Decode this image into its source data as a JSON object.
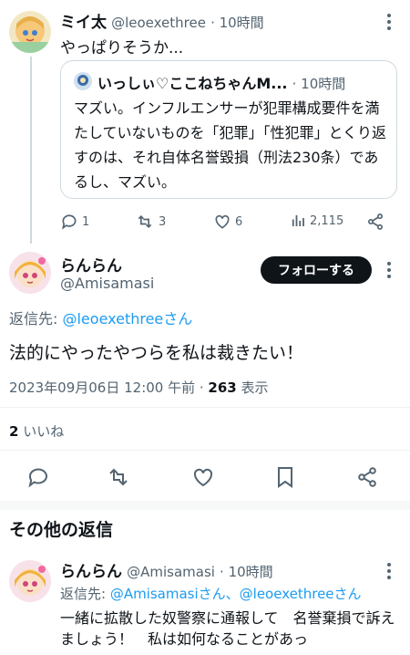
{
  "tweet1": {
    "name": "ミイ太",
    "handle": "@leoexethree",
    "time": "· 10時間",
    "text": "やっぱりそうか...",
    "quote": {
      "name": "いっしぃ♡ここねちゃんM...",
      "time": "· 10時間",
      "text": "マズい。インフルエンサーが犯罪構成要件を満たしていないものを「犯罪」「性犯罪」とくり返すのは、それ自体名誉毀損（刑法230条）であるし、マズい。"
    },
    "actions": {
      "reply_count": "1",
      "retweet_count": "3",
      "like_count": "6",
      "view_count": "2,115"
    }
  },
  "main_tweet": {
    "name": "らんらん",
    "handle": "@Amisamasi",
    "follow_label": "フォローする",
    "reply_prefix": "返信先: ",
    "reply_to": "@leoexethreeさん",
    "text": "法的にやったやつらを私は裁きたい！",
    "timestamp": "2023年09月06日 12:00 午前 · ",
    "views_count": "263",
    "views_label": " 表示",
    "likes_count": "2",
    "likes_label": " いいね"
  },
  "other_replies": {
    "heading": "その他の返信"
  },
  "reply1": {
    "name": "らんらん",
    "handle": "@Amisamasi",
    "time": "· 10時間",
    "reply_prefix": "返信先: ",
    "reply_to": "@Amisamasiさん、@leoexethreeさん",
    "text": "一緒に拡散した奴警察に通報して　名誉棄損で訴えましょう！　私は如何なることがあっ"
  },
  "colors": {
    "accent": "#1d9bf0",
    "text": "#0f1419",
    "muted": "#536471"
  }
}
